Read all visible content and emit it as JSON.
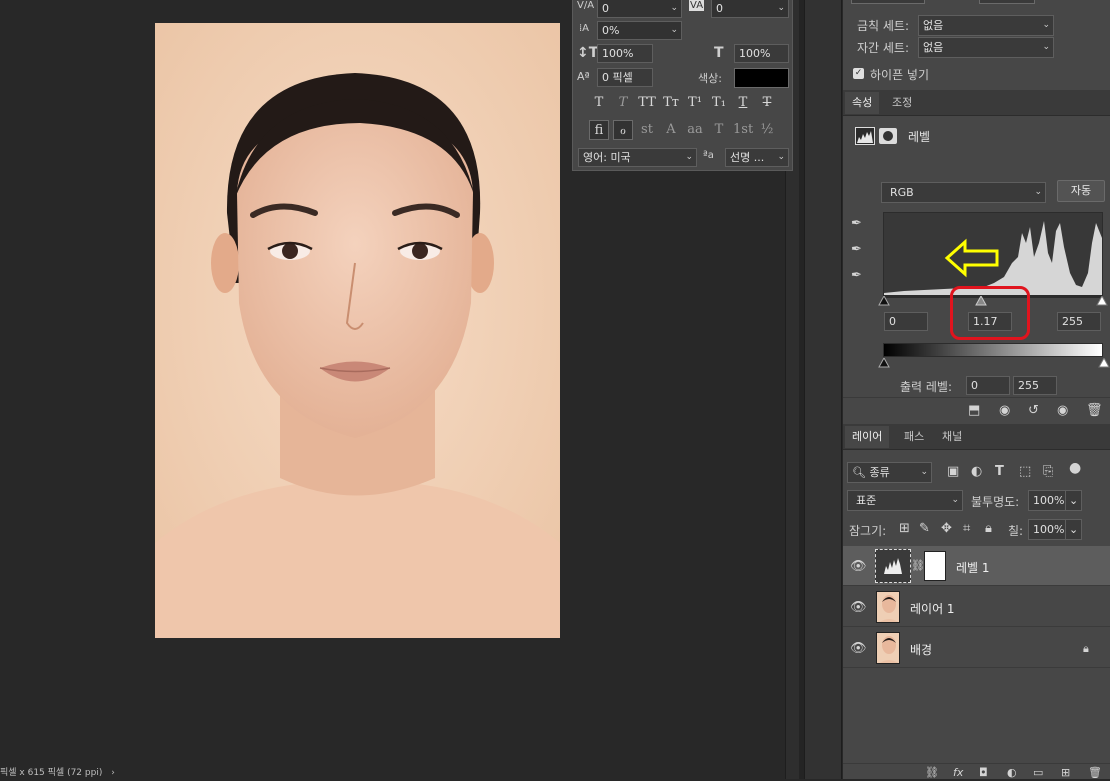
{
  "status": {
    "info": "픽셀 x 615 픽셀 (72 ppi)",
    "arrow": "›"
  },
  "character": {
    "kerning": "0",
    "tracking": "0",
    "baseline_shift_pct": "0%",
    "vertical_scale": "100%",
    "horizontal_scale": "100%",
    "baseline_shift": "0 픽셀",
    "color_label": "색상:",
    "color": "#000000",
    "language": "영어: 미국",
    "aa_icon": "ªa",
    "antialias": "선명 ...",
    "typo_row1": [
      "T",
      "T",
      "TT",
      "Tт",
      "T¹",
      "T₁",
      "T",
      "T"
    ],
    "typo_row2": [
      "fi",
      "ℴ",
      "st",
      "A",
      "aa",
      "T",
      "1st",
      "½"
    ]
  },
  "top_right": {
    "kerning_set_label": "금칙 세트:",
    "kerning_set_value": "없음",
    "spacing_set_label": "자간 세트:",
    "spacing_set_value": "없음",
    "hyphen_label": "하이픈 넣기",
    "hyphen_checked": true
  },
  "properties": {
    "tabs": [
      "속성",
      "조정"
    ],
    "title": "레벨",
    "channel": "RGB",
    "auto_label": "자동",
    "input_black": "0",
    "input_gamma": "1.17",
    "input_white": "255",
    "output_label": "출력 레벨:",
    "output_black": "0",
    "output_white": "255",
    "annotation_color": "#ffff00",
    "highlight_color": "#e0141e"
  },
  "layers": {
    "tabs": [
      "레이어",
      "패스",
      "채널"
    ],
    "filter_label": "종류",
    "blend_mode": "표준",
    "opacity_label": "불투명도:",
    "opacity": "100%",
    "lock_label": "잠그기:",
    "fill_label": "칠:",
    "fill": "100%",
    "items": [
      {
        "name": "레벨 1",
        "selected": true,
        "type": "adjustment"
      },
      {
        "name": "레이어 1",
        "selected": false,
        "type": "image"
      },
      {
        "name": "배경",
        "selected": false,
        "type": "image",
        "locked": true
      }
    ]
  },
  "icons": [
    "eye-icon",
    "lock-icon",
    "eyedropper-icon",
    "trash-icon",
    "link-icon",
    "fx-icon",
    "mask-icon",
    "adjustment-icon",
    "folder-icon",
    "new-layer-icon"
  ]
}
